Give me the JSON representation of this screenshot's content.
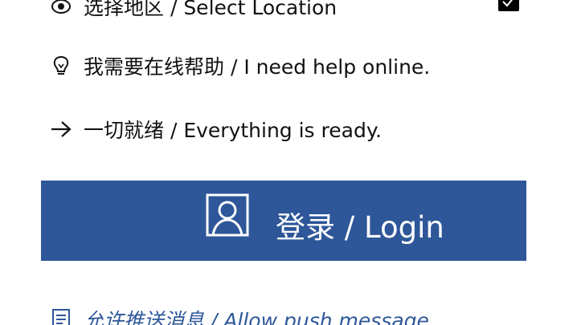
{
  "rows": {
    "location": {
      "label": "选择地区 / Select Location",
      "icon": "location-eye-icon",
      "checked": true
    },
    "help": {
      "label": "我需要在线帮助 / I need help online.",
      "icon": "lightbulb-icon"
    },
    "ready": {
      "label": "一切就绪 / Everything is ready.",
      "icon": "arrow-right-icon"
    }
  },
  "login_button": {
    "label": "登录 / Login",
    "icon": "user-portrait-icon",
    "color": "#2e5799"
  },
  "push": {
    "label": "允许推送消息 / Allow push message",
    "icon": "document-icon",
    "color": "#2e5799"
  }
}
